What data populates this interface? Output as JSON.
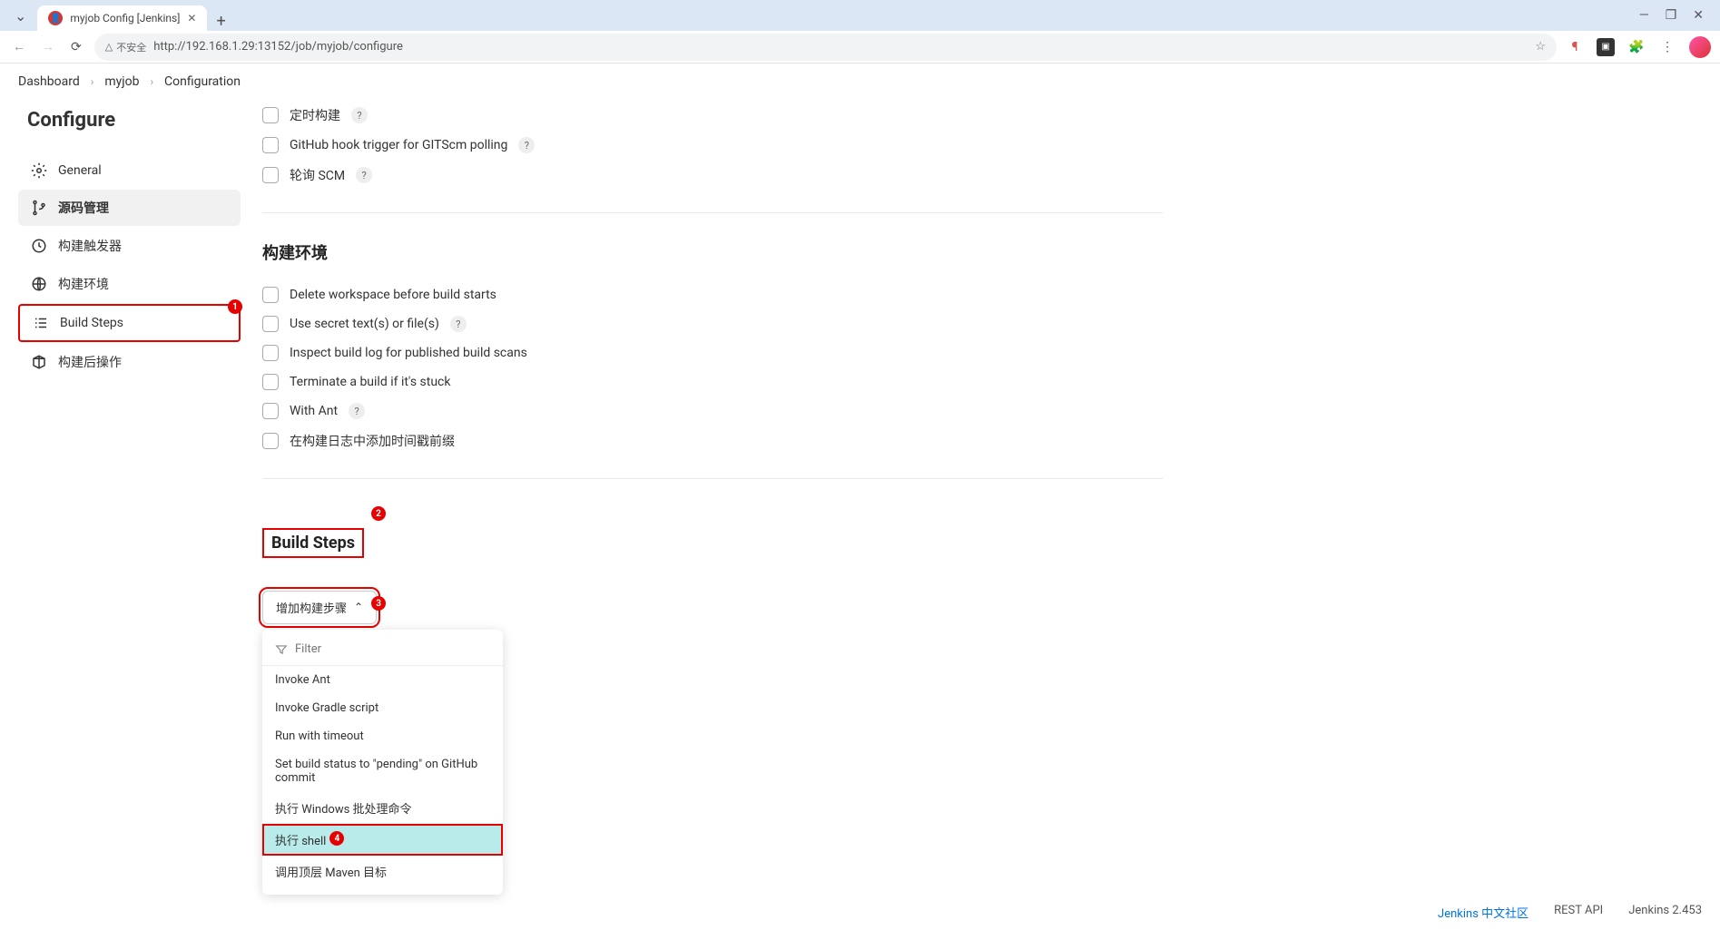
{
  "browser": {
    "tab_title": "myjob Config [Jenkins]",
    "security_label": "不安全",
    "url": "http://192.168.1.29:13152/job/myjob/configure"
  },
  "breadcrumb": {
    "items": [
      "Dashboard",
      "myjob",
      "Configuration"
    ]
  },
  "sidebar": {
    "title": "Configure",
    "items": [
      {
        "label": "General"
      },
      {
        "label": "源码管理"
      },
      {
        "label": "构建触发器"
      },
      {
        "label": "构建环境"
      },
      {
        "label": "Build Steps"
      },
      {
        "label": "构建后操作"
      }
    ]
  },
  "triggers": {
    "items": [
      {
        "label": "定时构建",
        "help": true
      },
      {
        "label": "GitHub hook trigger for GITScm polling",
        "help": true
      },
      {
        "label": "轮询 SCM",
        "help": true
      }
    ]
  },
  "build_env": {
    "title": "构建环境",
    "items": [
      {
        "label": "Delete workspace before build starts",
        "help": false
      },
      {
        "label": "Use secret text(s) or file(s)",
        "help": true
      },
      {
        "label": "Inspect build log for published build scans",
        "help": false
      },
      {
        "label": "Terminate a build if it's stuck",
        "help": false
      },
      {
        "label": "With Ant",
        "help": true
      },
      {
        "label": "在构建日志中添加时间戳前缀",
        "help": false
      }
    ]
  },
  "build_steps": {
    "title": "Build Steps",
    "add_button": "增加构建步骤",
    "filter_placeholder": "Filter",
    "menu_items": [
      "Invoke Ant",
      "Invoke Gradle script",
      "Run with timeout",
      "Set build status to \"pending\" on GitHub commit",
      "执行 Windows 批处理命令",
      "执行 shell",
      "调用顶层 Maven 目标"
    ]
  },
  "footer": {
    "community_link": "Jenkins 中文社区",
    "rest_api": "REST API",
    "version": "Jenkins 2.453"
  },
  "annotations": {
    "badge1": "1",
    "badge2": "2",
    "badge3": "3",
    "badge4": "4"
  }
}
